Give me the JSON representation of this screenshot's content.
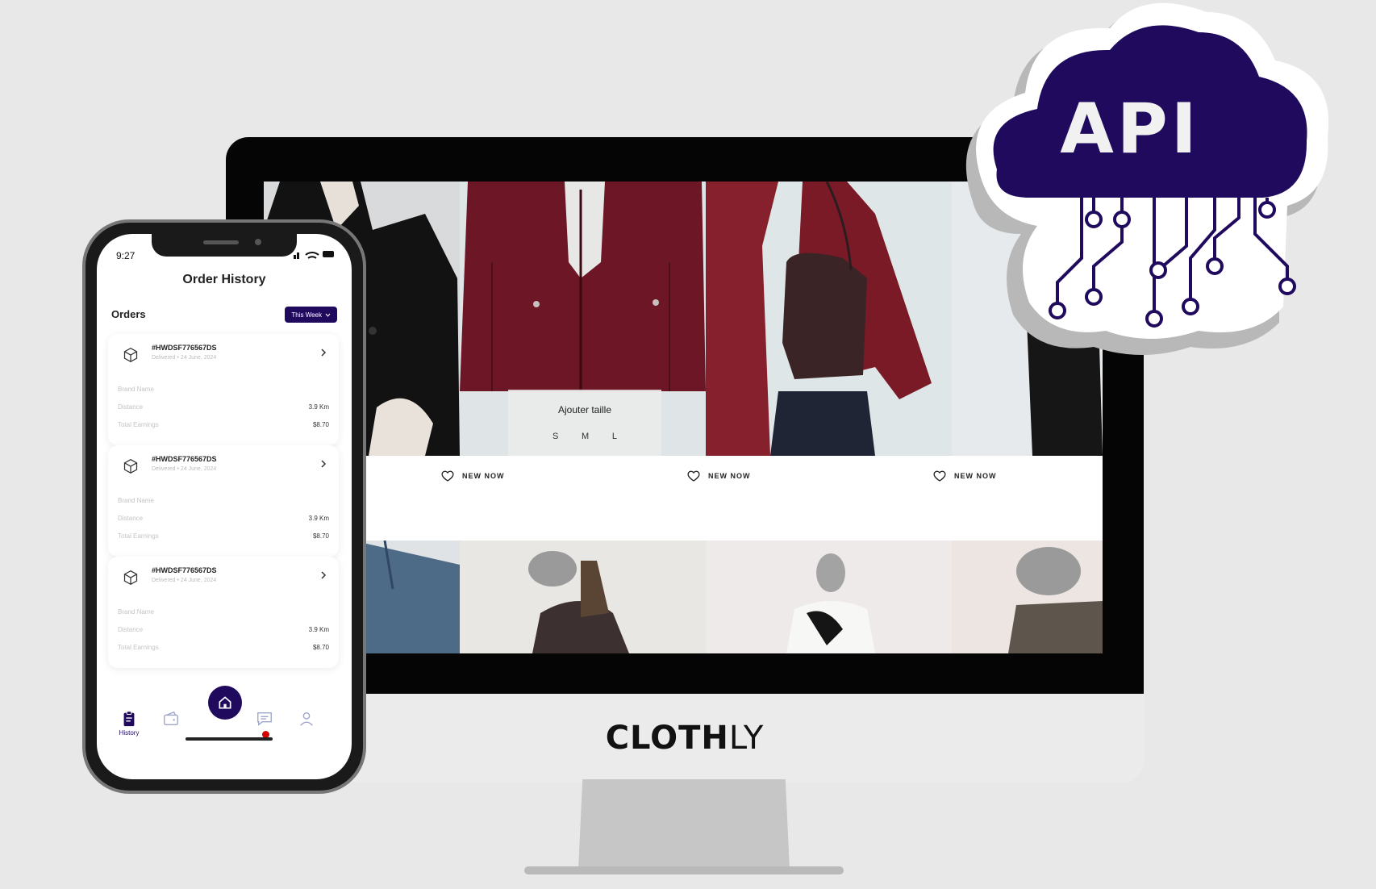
{
  "phone": {
    "status_time": "9:27",
    "title": "Order History",
    "orders_label": "Orders",
    "filter_label": "This Week",
    "orders": [
      {
        "id": "#HWDSF776567DS",
        "sub": "Delivered • 24 June, 2024",
        "brand_label": "Brand Name",
        "distance_label": "Distance",
        "distance": "3.9 Km",
        "earnings_label": "Total Earnings",
        "earnings": "$8.70"
      },
      {
        "id": "#HWDSF776567DS",
        "sub": "Delivered • 24 June, 2024",
        "brand_label": "Brand Name",
        "distance_label": "Distance",
        "distance": "3.9 Km",
        "earnings_label": "Total Earnings",
        "earnings": "$8.70"
      },
      {
        "id": "#HWDSF776567DS",
        "sub": "Delivered • 24 June, 2024",
        "brand_label": "Brand Name",
        "distance_label": "Distance",
        "distance": "3.9 Km",
        "earnings_label": "Total Earnings",
        "earnings": "$8.70"
      }
    ],
    "tabs": {
      "history_label": "History"
    },
    "accent_color": "#200a5e",
    "badge_color": "#d40000"
  },
  "monitor": {
    "brand_bold": "CLOTH",
    "brand_light": "LY",
    "size_title": "Ajouter taille",
    "sizes": [
      "S",
      "M",
      "L"
    ],
    "product_labels": [
      "NEW NOW",
      "NEW NOW",
      "NEW NOW"
    ]
  },
  "api": {
    "label": "API",
    "cloud_color": "#200a5e"
  }
}
